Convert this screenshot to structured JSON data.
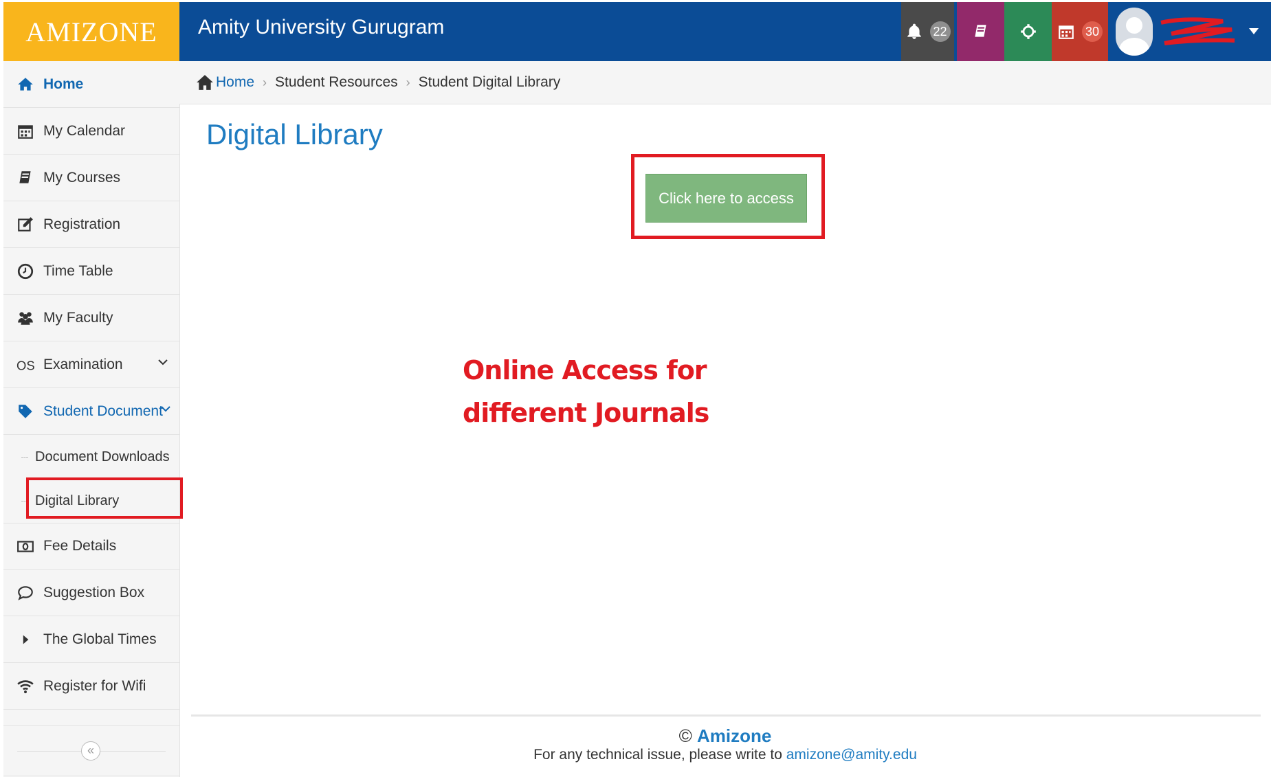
{
  "app": {
    "logo_text": "AMIZONE",
    "title": "Amity University Gurugram"
  },
  "topbar": {
    "notifications_count": "22",
    "calendar_count": "30"
  },
  "sidebar": {
    "items": [
      {
        "label": "Home"
      },
      {
        "label": "My Calendar"
      },
      {
        "label": "My Courses"
      },
      {
        "label": "Registration"
      },
      {
        "label": "Time Table"
      },
      {
        "label": "My Faculty"
      },
      {
        "label": "Examination"
      },
      {
        "label": "Student Document"
      },
      {
        "label": "Fee Details"
      },
      {
        "label": "Suggestion Box"
      },
      {
        "label": "The Global Times"
      },
      {
        "label": "Register for Wifi"
      }
    ],
    "subitems": [
      {
        "label": "Document Downloads"
      },
      {
        "label": "Digital Library"
      }
    ],
    "collapse_symbol": "«"
  },
  "breadcrumb": {
    "home": "Home",
    "level1": "Student Resources",
    "level2": "Student Digital Library"
  },
  "main": {
    "title": "Digital Library",
    "access_button": "Click here to access",
    "annotation_line1": "Online Access for",
    "annotation_line2": "different Journals"
  },
  "footer": {
    "copyright_symbol": "©",
    "brand": "Amizone",
    "text": "For any technical issue, please write to",
    "email": "amizone@amity.edu"
  },
  "colors": {
    "topbar": "#0b4c96",
    "logo_bg": "#f9b51c",
    "accent": "#1f7cc1",
    "highlight": "#e11b22",
    "button_green": "#7fb77e"
  }
}
